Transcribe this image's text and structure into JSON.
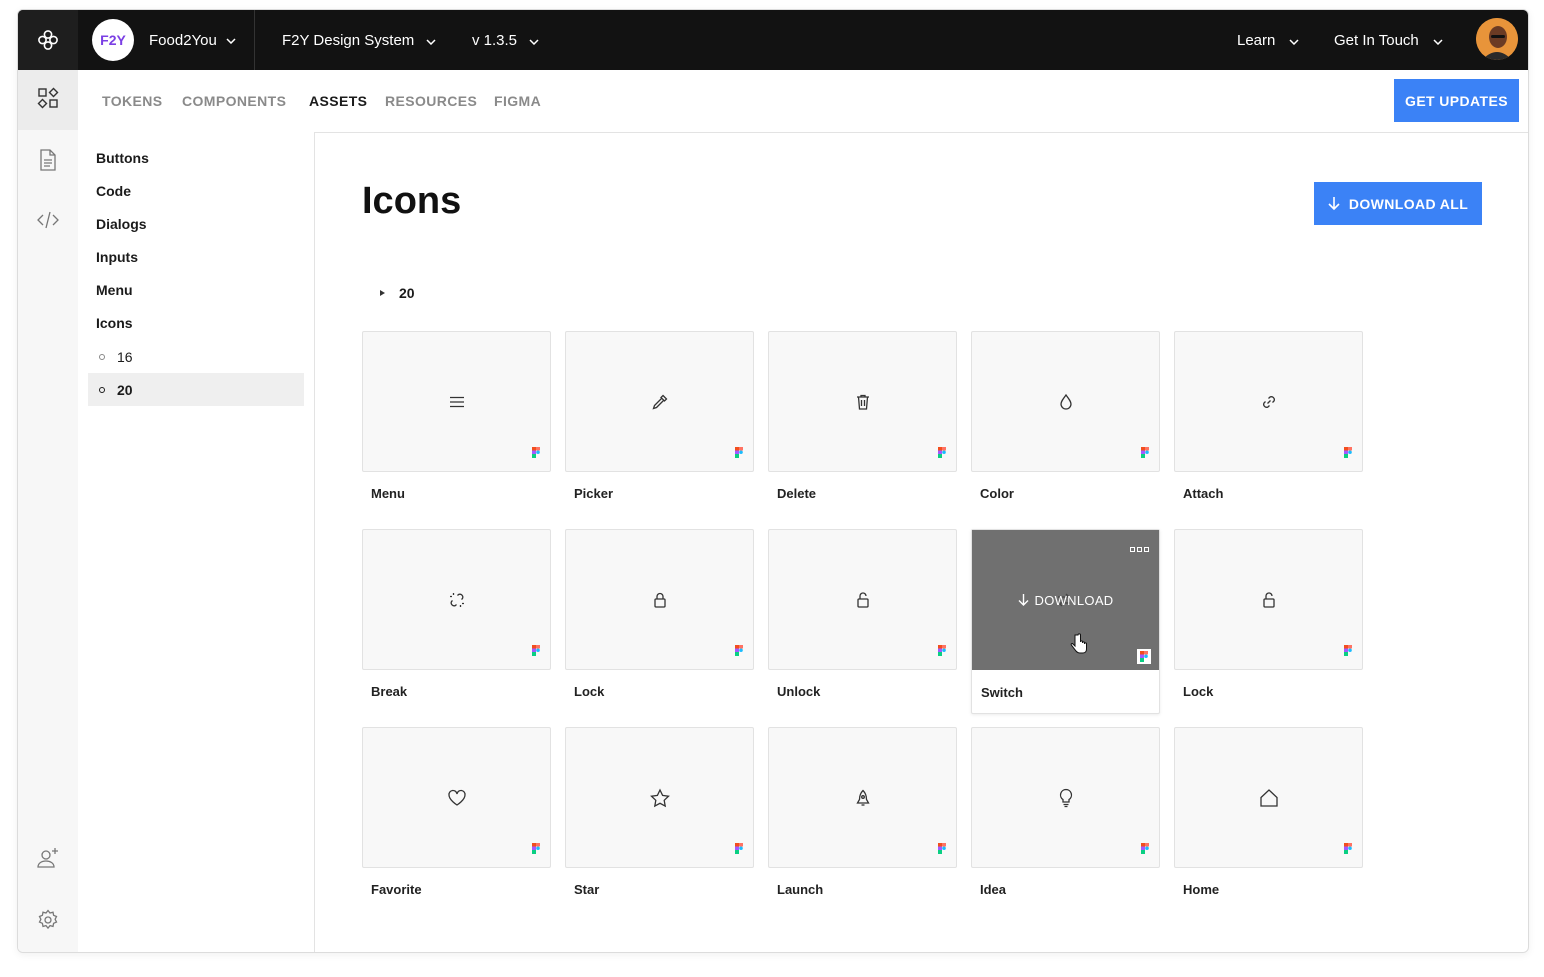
{
  "topbar": {
    "org_badge": "F2Y",
    "org_name": "Food2You",
    "project": "F2Y Design System",
    "version": "v 1.3.5",
    "learn": "Learn",
    "get_in_touch": "Get In Touch"
  },
  "nav": {
    "tabs": [
      "TOKENS",
      "COMPONENTS",
      "ASSETS",
      "RESOURCES",
      "FIGMA"
    ],
    "active_tab": "ASSETS",
    "get_updates": "GET UPDATES"
  },
  "sidebar": {
    "items": [
      "Buttons",
      "Code",
      "Dialogs",
      "Inputs",
      "Menu",
      "Icons"
    ],
    "sub_items": [
      "16",
      "20"
    ],
    "active_sub": "20"
  },
  "main": {
    "title": "Icons",
    "download_all": "DOWNLOAD ALL",
    "group_size": "20",
    "hover_download": "DOWNLOAD",
    "icons": [
      {
        "label": "Menu",
        "icon": "menu-icon"
      },
      {
        "label": "Picker",
        "icon": "picker-icon"
      },
      {
        "label": "Delete",
        "icon": "trash-icon"
      },
      {
        "label": "Color",
        "icon": "drop-icon"
      },
      {
        "label": "Attach",
        "icon": "link-icon"
      },
      {
        "label": "Break",
        "icon": "broken-link-icon"
      },
      {
        "label": "Lock",
        "icon": "lock-icon"
      },
      {
        "label": "Unlock",
        "icon": "unlock-icon"
      },
      {
        "label": "Switch",
        "icon": "switch-icon"
      },
      {
        "label": "Lock",
        "icon": "unlock-icon"
      },
      {
        "label": "Favorite",
        "icon": "heart-icon"
      },
      {
        "label": "Star",
        "icon": "star-icon"
      },
      {
        "label": "Launch",
        "icon": "rocket-icon"
      },
      {
        "label": "Idea",
        "icon": "lightbulb-icon"
      },
      {
        "label": "Home",
        "icon": "home-icon"
      }
    ]
  },
  "colors": {
    "accent": "#3b82f6",
    "topbar": "#121212",
    "badge_text": "#7b3fe4"
  }
}
